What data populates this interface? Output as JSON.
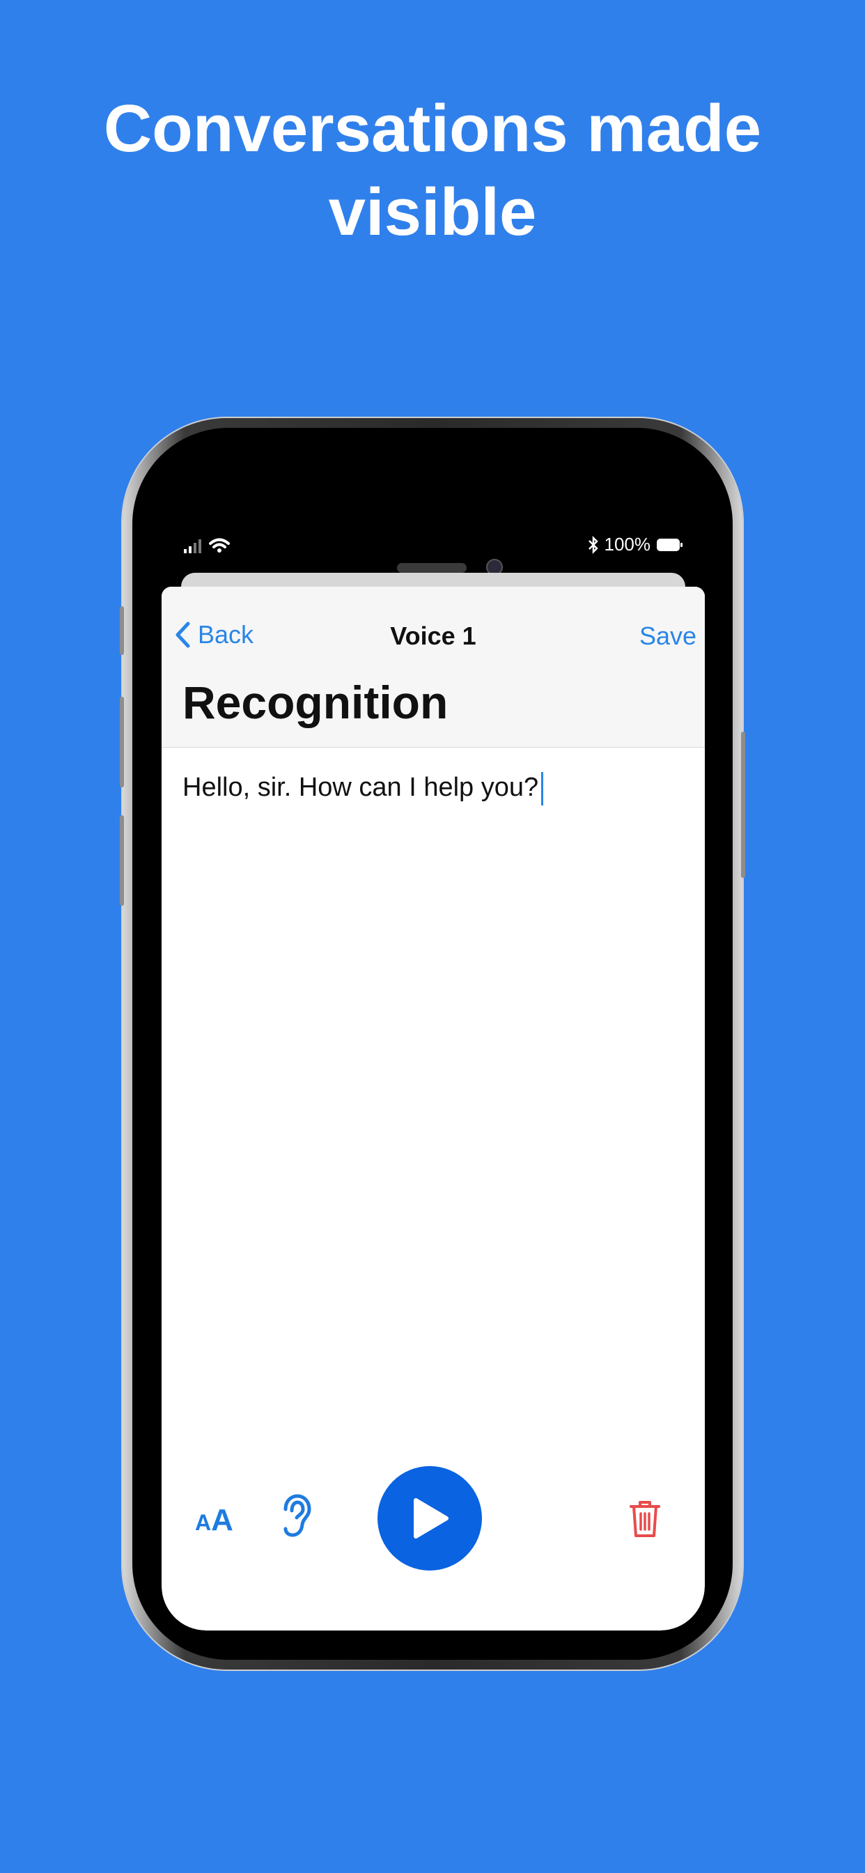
{
  "headline": {
    "line1": "Conversations made",
    "line2": "visible"
  },
  "status_bar": {
    "battery_text": "100%",
    "icons": [
      "signal-icon",
      "wifi-icon",
      "bluetooth-icon",
      "battery-icon"
    ]
  },
  "nav": {
    "back_label": "Back",
    "title": "Voice 1",
    "save_label": "Save",
    "large_title": "Recognition"
  },
  "transcript": {
    "text": "Hello, sir. How can I help you?"
  },
  "toolbar": {
    "font_size_label": "AA",
    "icons": [
      "font-size-icon",
      "ear-icon",
      "play-icon",
      "trash-icon"
    ]
  },
  "colors": {
    "background": "#3080EB",
    "accent": "#2A86E6",
    "play_button": "#0A63E0",
    "delete": "#E94B4B"
  }
}
